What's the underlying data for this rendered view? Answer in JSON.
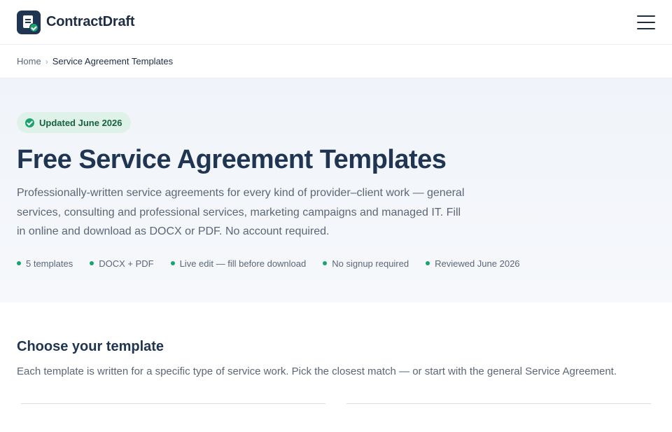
{
  "header": {
    "brand_name": "ContractDraft",
    "logo_icon": "document-check-icon",
    "menu_icon": "hamburger-menu-icon"
  },
  "breadcrumb": {
    "home": "Home",
    "separator": "›",
    "current": "Service Agreement Templates"
  },
  "hero": {
    "badge": "Updated June 2026",
    "title": "Free Service Agreement Templates",
    "description": "Professionally-written service agreements for every kind of provider–client work — general services, consulting and professional services, marketing campaigns and managed IT. Fill in online and download as DOCX or PDF. No account required.",
    "features": [
      "5 templates",
      "DOCX + PDF",
      "Live edit — fill before download",
      "No signup required",
      "Reviewed June 2026"
    ]
  },
  "section": {
    "title": "Choose your template",
    "description": "Each template is written for a specific type of service work. Pick the closest match — or start with the general Service Agreement."
  },
  "colors": {
    "brand_dark": "#1f3552",
    "accent_green": "#1aa36f",
    "badge_bg": "#dff2e9",
    "text_muted": "#5b6778"
  }
}
